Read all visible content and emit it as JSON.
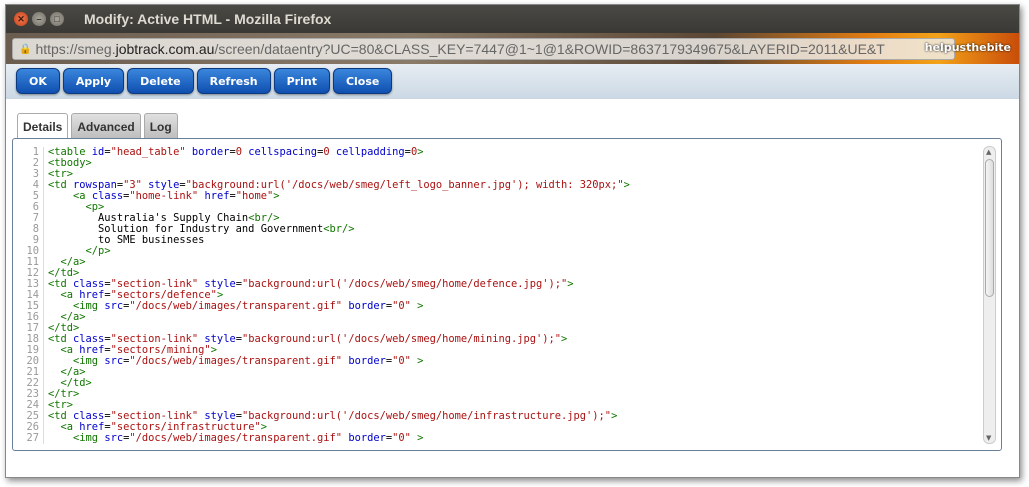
{
  "window": {
    "title": "Modify: Active HTML - Mozilla Firefox"
  },
  "urlbar": {
    "pre": "https://smeg.",
    "domain": "jobtrack.com.au",
    "post": "/screen/dataentry?UC=80&CLASS_KEY=7447@1~1@1&ROWID=8637179349675&LAYERID=2011&UE&T"
  },
  "persona": "helpusthebite",
  "toolbar": {
    "buttons": [
      "OK",
      "Apply",
      "Delete",
      "Refresh",
      "Print",
      "Close"
    ]
  },
  "tabs": [
    {
      "label": "Details",
      "active": true
    },
    {
      "label": "Advanced",
      "active": false
    },
    {
      "label": "Log",
      "active": false
    }
  ],
  "code": [
    [
      [
        "t",
        "<table "
      ],
      [
        "a",
        "id"
      ],
      [
        "x",
        "="
      ],
      [
        "v",
        "\"head_table\" "
      ],
      [
        "a",
        "border"
      ],
      [
        "x",
        "="
      ],
      [
        "v",
        "0 "
      ],
      [
        "a",
        "cellspacing"
      ],
      [
        "x",
        "="
      ],
      [
        "v",
        "0 "
      ],
      [
        "a",
        "cellpadding"
      ],
      [
        "x",
        "="
      ],
      [
        "v",
        "0"
      ],
      [
        "t",
        ">"
      ]
    ],
    [
      [
        "t",
        "<tbody>"
      ]
    ],
    [
      [
        "t",
        "<tr>"
      ]
    ],
    [
      [
        "t",
        "<td "
      ],
      [
        "a",
        "rowspan"
      ],
      [
        "x",
        "="
      ],
      [
        "v",
        "\"3\" "
      ],
      [
        "a",
        "style"
      ],
      [
        "x",
        "="
      ],
      [
        "v",
        "\"background:url('/docs/web/smeg/left_logo_banner.jpg'); width: 320px;\""
      ],
      [
        "t",
        ">"
      ]
    ],
    [
      [
        "x",
        "    "
      ],
      [
        "t",
        "<a "
      ],
      [
        "a",
        "class"
      ],
      [
        "x",
        "="
      ],
      [
        "v",
        "\"home-link\" "
      ],
      [
        "a",
        "href"
      ],
      [
        "x",
        "="
      ],
      [
        "v",
        "\"home\""
      ],
      [
        "t",
        ">"
      ]
    ],
    [
      [
        "x",
        "      "
      ],
      [
        "t",
        "<p>"
      ]
    ],
    [
      [
        "x",
        "        Australia's Supply Chain"
      ],
      [
        "t",
        "<br/>"
      ]
    ],
    [
      [
        "x",
        "        Solution for Industry and Government"
      ],
      [
        "t",
        "<br/>"
      ]
    ],
    [
      [
        "x",
        "        to SME businesses"
      ]
    ],
    [
      [
        "x",
        "      "
      ],
      [
        "t",
        "</p>"
      ]
    ],
    [
      [
        "x",
        "  "
      ],
      [
        "t",
        "</a>"
      ]
    ],
    [
      [
        "t",
        "</td>"
      ]
    ],
    [
      [
        "t",
        "<td "
      ],
      [
        "a",
        "class"
      ],
      [
        "x",
        "="
      ],
      [
        "v",
        "\"section-link\" "
      ],
      [
        "a",
        "style"
      ],
      [
        "x",
        "="
      ],
      [
        "v",
        "\"background:url('/docs/web/smeg/home/defence.jpg');\""
      ],
      [
        "t",
        ">"
      ]
    ],
    [
      [
        "x",
        "  "
      ],
      [
        "t",
        "<a "
      ],
      [
        "a",
        "href"
      ],
      [
        "x",
        "="
      ],
      [
        "v",
        "\"sectors/defence\""
      ],
      [
        "t",
        ">"
      ]
    ],
    [
      [
        "x",
        "    "
      ],
      [
        "t",
        "<img "
      ],
      [
        "a",
        "src"
      ],
      [
        "x",
        "="
      ],
      [
        "v",
        "\"/docs/web/images/transparent.gif\" "
      ],
      [
        "a",
        "border"
      ],
      [
        "x",
        "="
      ],
      [
        "v",
        "\"0\" "
      ],
      [
        "t",
        ">"
      ]
    ],
    [
      [
        "x",
        "  "
      ],
      [
        "t",
        "</a>"
      ]
    ],
    [
      [
        "t",
        "</td>"
      ]
    ],
    [
      [
        "t",
        "<td "
      ],
      [
        "a",
        "class"
      ],
      [
        "x",
        "="
      ],
      [
        "v",
        "\"section-link\" "
      ],
      [
        "a",
        "style"
      ],
      [
        "x",
        "="
      ],
      [
        "v",
        "\"background:url('/docs/web/smeg/home/mining.jpg');\""
      ],
      [
        "t",
        ">"
      ]
    ],
    [
      [
        "x",
        "  "
      ],
      [
        "t",
        "<a "
      ],
      [
        "a",
        "href"
      ],
      [
        "x",
        "="
      ],
      [
        "v",
        "\"sectors/mining\""
      ],
      [
        "t",
        ">"
      ]
    ],
    [
      [
        "x",
        "    "
      ],
      [
        "t",
        "<img "
      ],
      [
        "a",
        "src"
      ],
      [
        "x",
        "="
      ],
      [
        "v",
        "\"/docs/web/images/transparent.gif\" "
      ],
      [
        "a",
        "border"
      ],
      [
        "x",
        "="
      ],
      [
        "v",
        "\"0\" "
      ],
      [
        "t",
        ">"
      ]
    ],
    [
      [
        "x",
        "  "
      ],
      [
        "t",
        "</a>"
      ]
    ],
    [
      [
        "x",
        "  "
      ],
      [
        "t",
        "</td>"
      ]
    ],
    [
      [
        "t",
        "</tr>"
      ]
    ],
    [
      [
        "t",
        "<tr>"
      ]
    ],
    [
      [
        "t",
        "<td "
      ],
      [
        "a",
        "class"
      ],
      [
        "x",
        "="
      ],
      [
        "v",
        "\"section-link\" "
      ],
      [
        "a",
        "style"
      ],
      [
        "x",
        "="
      ],
      [
        "v",
        "\"background:url('/docs/web/smeg/home/infrastructure.jpg');\""
      ],
      [
        "t",
        ">"
      ]
    ],
    [
      [
        "x",
        "  "
      ],
      [
        "t",
        "<a "
      ],
      [
        "a",
        "href"
      ],
      [
        "x",
        "="
      ],
      [
        "v",
        "\"sectors/infrastructure\""
      ],
      [
        "t",
        ">"
      ]
    ],
    [
      [
        "x",
        "    "
      ],
      [
        "t",
        "<img "
      ],
      [
        "a",
        "src"
      ],
      [
        "x",
        "="
      ],
      [
        "v",
        "\"/docs/web/images/transparent.gif\" "
      ],
      [
        "a",
        "border"
      ],
      [
        "x",
        "="
      ],
      [
        "v",
        "\"0\" "
      ],
      [
        "t",
        ">"
      ]
    ]
  ]
}
